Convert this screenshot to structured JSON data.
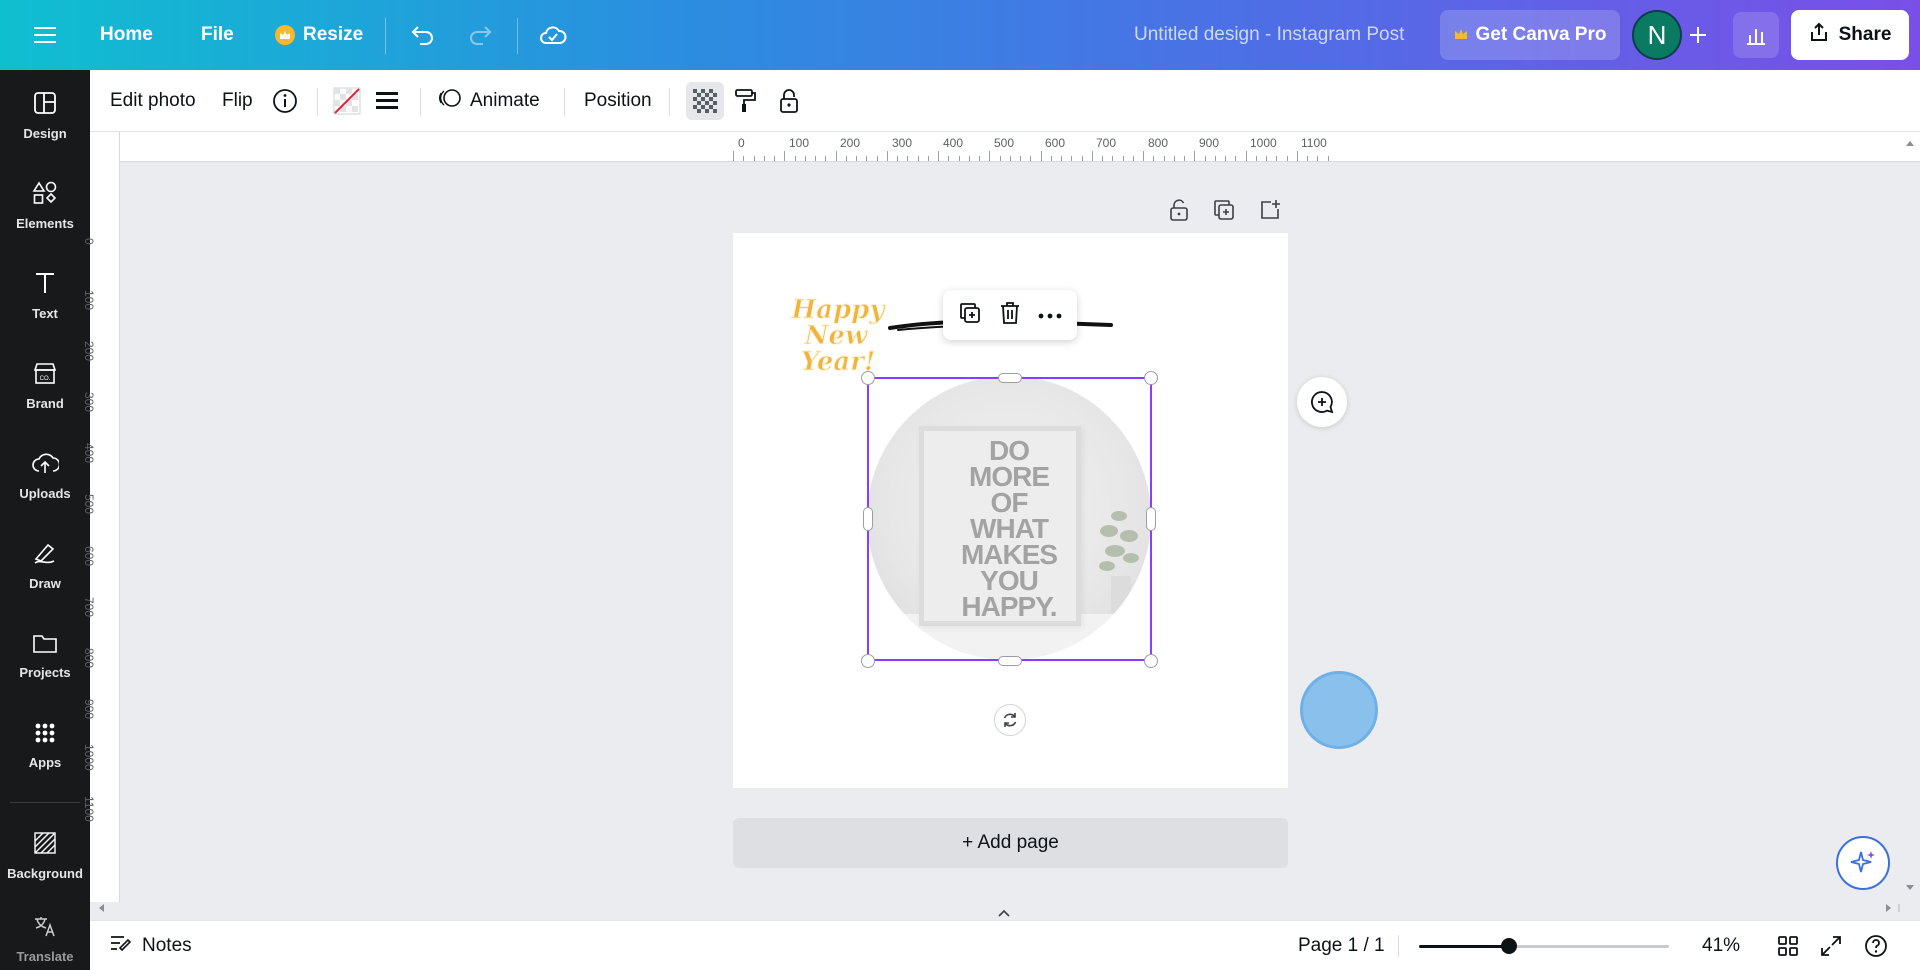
{
  "topbar": {
    "home": "Home",
    "file": "File",
    "resize": "Resize",
    "title": "Untitled design - Instagram Post",
    "get_pro": "Get Canva Pro",
    "avatar_initial": "N",
    "share": "Share"
  },
  "rail": {
    "items": [
      {
        "label": "Design",
        "icon": "design-icon"
      },
      {
        "label": "Elements",
        "icon": "elements-icon"
      },
      {
        "label": "Text",
        "icon": "text-icon"
      },
      {
        "label": "Brand",
        "icon": "brand-icon"
      },
      {
        "label": "Uploads",
        "icon": "uploads-icon"
      },
      {
        "label": "Draw",
        "icon": "draw-icon"
      },
      {
        "label": "Projects",
        "icon": "projects-icon"
      },
      {
        "label": "Apps",
        "icon": "apps-icon"
      },
      {
        "label": "Background",
        "icon": "background-icon"
      },
      {
        "label": "Translate",
        "icon": "translate-icon"
      }
    ]
  },
  "toolbar": {
    "edit_photo": "Edit photo",
    "flip": "Flip",
    "animate": "Animate",
    "position": "Position"
  },
  "rulers": {
    "top": [
      "0",
      "100",
      "200",
      "300",
      "400",
      "500",
      "600",
      "700",
      "800",
      "900",
      "1000",
      "1100"
    ],
    "left": [
      "0",
      "100",
      "200",
      "300",
      "400",
      "500",
      "600",
      "700",
      "800",
      "900",
      "1000",
      "1100"
    ]
  },
  "canvas": {
    "poster_lines": [
      "DO",
      "MORE",
      "OF",
      "WHAT",
      "MAKES",
      "YOU",
      "HAPPY."
    ],
    "sticker_lines": [
      "Happy",
      "New",
      "Year!"
    ],
    "add_page": "+ Add page"
  },
  "footer": {
    "notes": "Notes",
    "page": "Page 1 / 1",
    "zoom": "41%",
    "zoom_level": 0.36
  },
  "colors": {
    "selection": "#8b3dff",
    "rail_bg": "#18191b",
    "accent_gold": "#f5b82e"
  }
}
